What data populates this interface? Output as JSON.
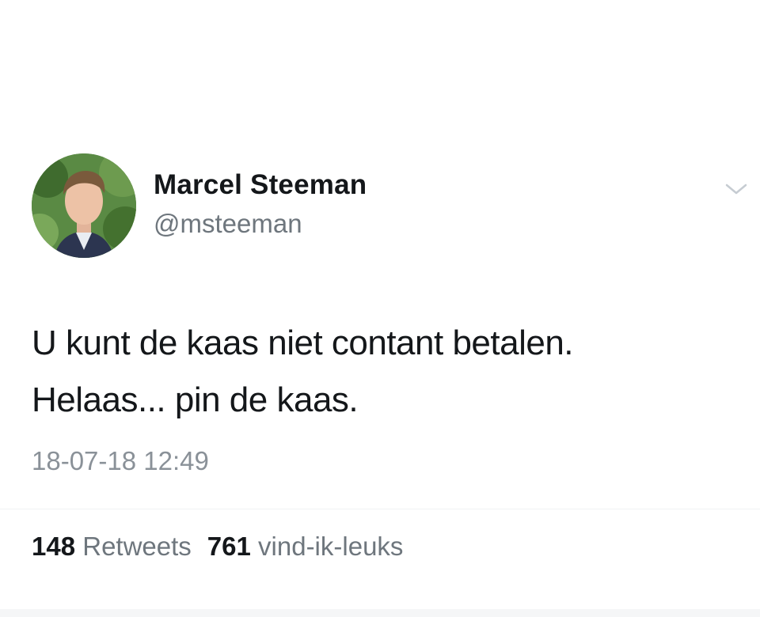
{
  "user": {
    "name": "Marcel Steeman",
    "handle": "@msteeman"
  },
  "tweet": {
    "lines": [
      "U kunt de kaas niet contant betalen.",
      "Helaas... pin de kaas."
    ],
    "timestamp": "18-07-18 12:49"
  },
  "stats": {
    "retweets_count": "148",
    "retweets_label": "Retweets",
    "likes_count": "761",
    "likes_label": "vind-ik-leuks"
  },
  "icons": {
    "menu": "chevron-down-icon"
  },
  "colors": {
    "text": "#14171a",
    "secondary": "#6e767d",
    "timestamp": "#8a9198"
  }
}
